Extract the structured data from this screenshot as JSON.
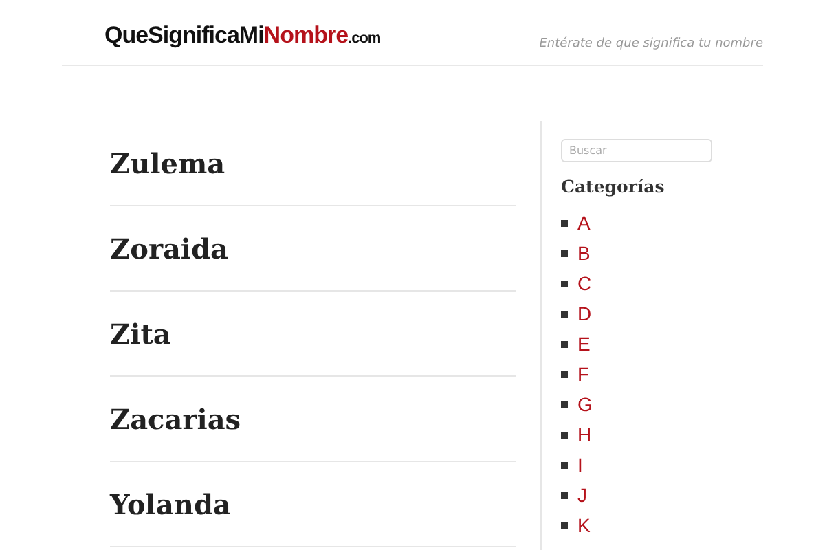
{
  "header": {
    "logo": [
      {
        "text": "QueSignificaMi",
        "kind": "main"
      },
      {
        "text": "Nombre",
        "kind": "accent"
      },
      {
        "text": ".com",
        "kind": "suffix"
      }
    ],
    "tagline": "Entérate de que significa tu nombre"
  },
  "names": [
    "Zulema",
    "Zoraida",
    "Zita",
    "Zacarias",
    "Yolanda"
  ],
  "sidebar": {
    "search": {
      "placeholder": "Buscar"
    },
    "title": "Categorías",
    "categories": [
      "A",
      "B",
      "C",
      "D",
      "E",
      "F",
      "G",
      "H",
      "I",
      "J",
      "K"
    ]
  }
}
